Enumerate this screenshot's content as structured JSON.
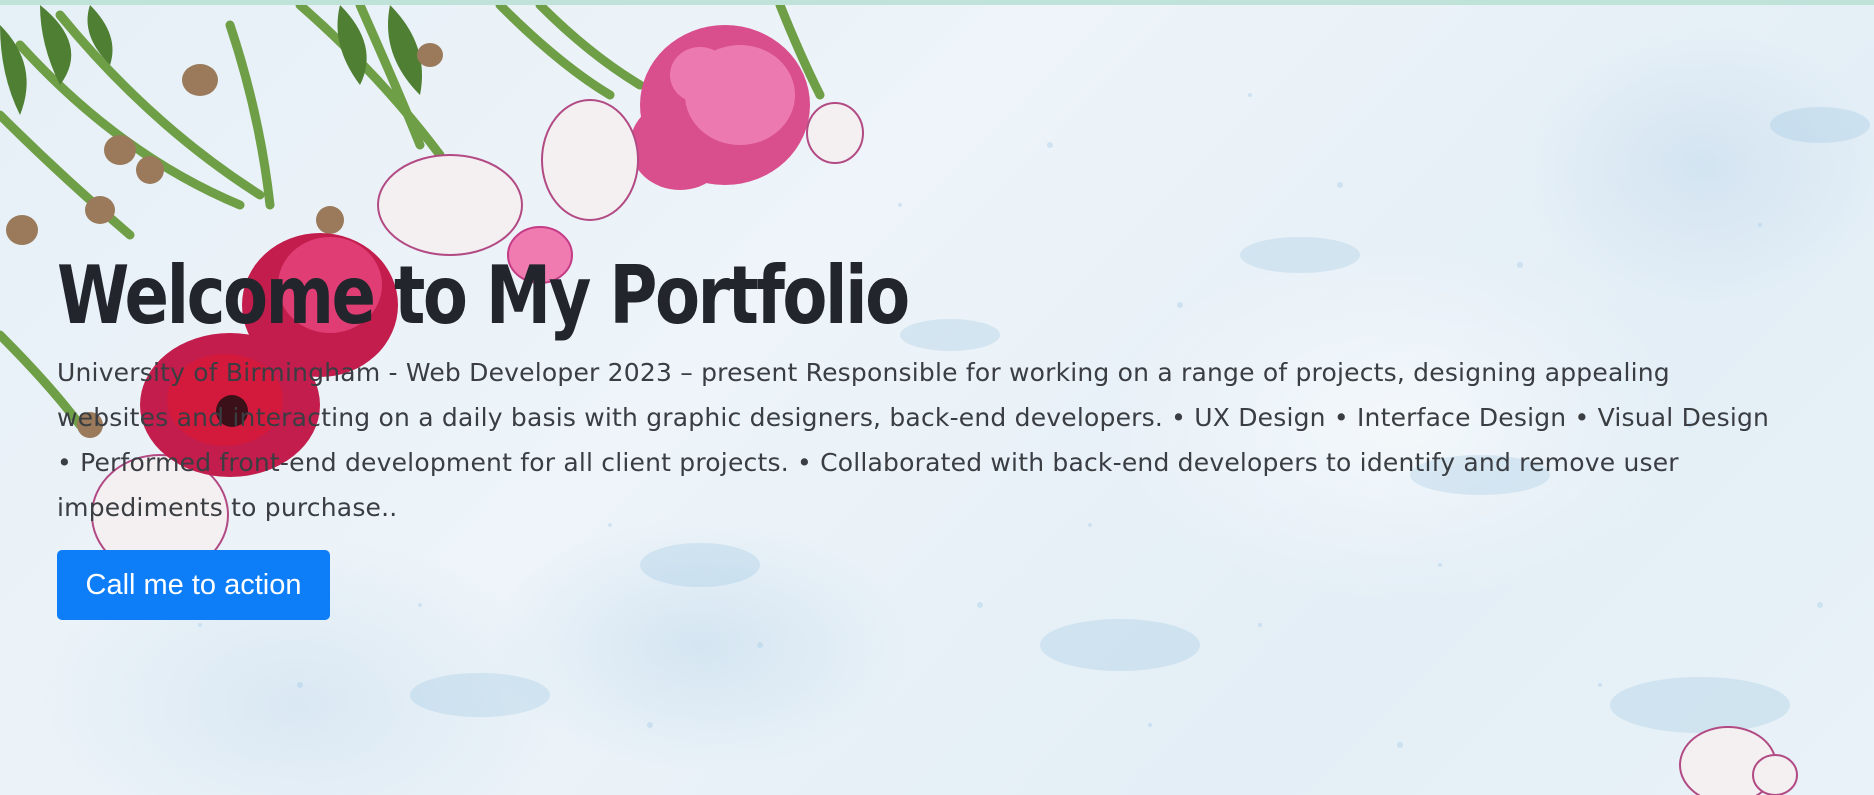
{
  "theme": {
    "accent": "#0d7ef8",
    "background": "#e9f2f8",
    "title_color": "#22252b",
    "text_color": "#3a3d42"
  },
  "hero": {
    "title": "Welcome to My Portfolio",
    "description": "University of Birmingham - Web Developer 2023 – present Responsible for working on a range of projects, designing appealing websites and interacting on a daily basis with graphic designers, back-end developers. • UX Design • Interface Design • Visual Design • Performed front-end development for all client projects. • Collaborated with back-end developers to identify and remove user impediments to purchase..",
    "cta_label": "Call me to action"
  }
}
